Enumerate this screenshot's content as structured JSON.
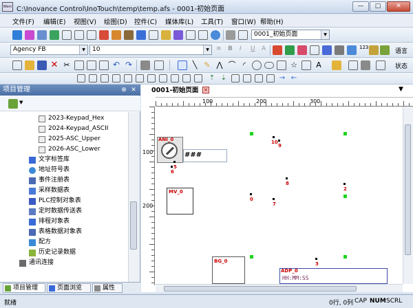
{
  "window": {
    "title": "C:\\Inovance Control\\InoTouch\\temp\\temp.afs - 0001-初始页面",
    "logo_text": "Wem",
    "min_icon": "—",
    "max_icon": "□",
    "close_icon": "✕"
  },
  "menu": [
    {
      "label": "文件(F)"
    },
    {
      "label": "编辑(E)"
    },
    {
      "label": "视图(V)"
    },
    {
      "label": "绘图(D)"
    },
    {
      "label": "控件(C)"
    },
    {
      "label": "媒体库(L)"
    },
    {
      "label": "工具(T)"
    },
    {
      "label": "窗口(W)"
    },
    {
      "label": "帮助(H)"
    }
  ],
  "toolbar": {
    "page_select": "0001_初始页面",
    "font_family": "Agency FB",
    "font_size": "10",
    "lang_label": "语言",
    "state_label": "状态",
    "bold": "B",
    "italic": "I",
    "underline": "U",
    "num_icon": "123",
    "dropdown_arrow": "▼"
  },
  "panel": {
    "title": "项目管理",
    "pin_icon": "⊕",
    "close_icon": "✕",
    "tree_items": [
      {
        "label": "2023-Keypad_Hex",
        "icon": "grid-doc-icon"
      },
      {
        "label": "2024-Keypad_ASCII",
        "icon": "grid-doc-icon"
      },
      {
        "label": "2025-ASC_Upper",
        "icon": "grid-doc-icon"
      },
      {
        "label": "2026-ASC_Lower",
        "icon": "grid-doc-icon"
      },
      {
        "label": "文字标签库",
        "icon": "text-label-icon"
      },
      {
        "label": "地址符号表",
        "icon": "address-icon"
      },
      {
        "label": "事件注册表",
        "icon": "event-icon"
      },
      {
        "label": "采样数据表",
        "icon": "sample-icon"
      },
      {
        "label": "PLC控制对象表",
        "icon": "plc-icon"
      },
      {
        "label": "定时数据传送表",
        "icon": "timer-icon"
      },
      {
        "label": "排程对象表",
        "icon": "schedule-icon"
      },
      {
        "label": "表格数据对象表",
        "icon": "table-icon"
      },
      {
        "label": "配方",
        "icon": "recipe-icon"
      },
      {
        "label": "历史记录数据",
        "icon": "history-icon"
      },
      {
        "label": "通讯连接",
        "icon": "connection-icon"
      }
    ],
    "tabs": [
      {
        "label": "项目管理"
      },
      {
        "label": "页面浏览"
      },
      {
        "label": "属性"
      }
    ]
  },
  "editor": {
    "tab_title": "0001-初始页面",
    "tab_menu_icon": "▼",
    "ruler_h": [
      "100",
      "200",
      "300"
    ],
    "ruler_v": [
      "100",
      "200"
    ],
    "objects": {
      "ani_label": "ANI_0",
      "ani_text": "###",
      "mv_label": "MV_0",
      "bg_label": "BG_0",
      "adp_label": "ADP_0",
      "adp_text": "HH:MM:SS"
    },
    "marks": [
      "10",
      "9",
      "5",
      "6",
      "8",
      "2",
      "0",
      "7",
      "3"
    ]
  },
  "status": {
    "left": "就绪",
    "position": "0行, 0列",
    "cap": "CAP",
    "num": "NUM",
    "scrl": "SCRL"
  }
}
